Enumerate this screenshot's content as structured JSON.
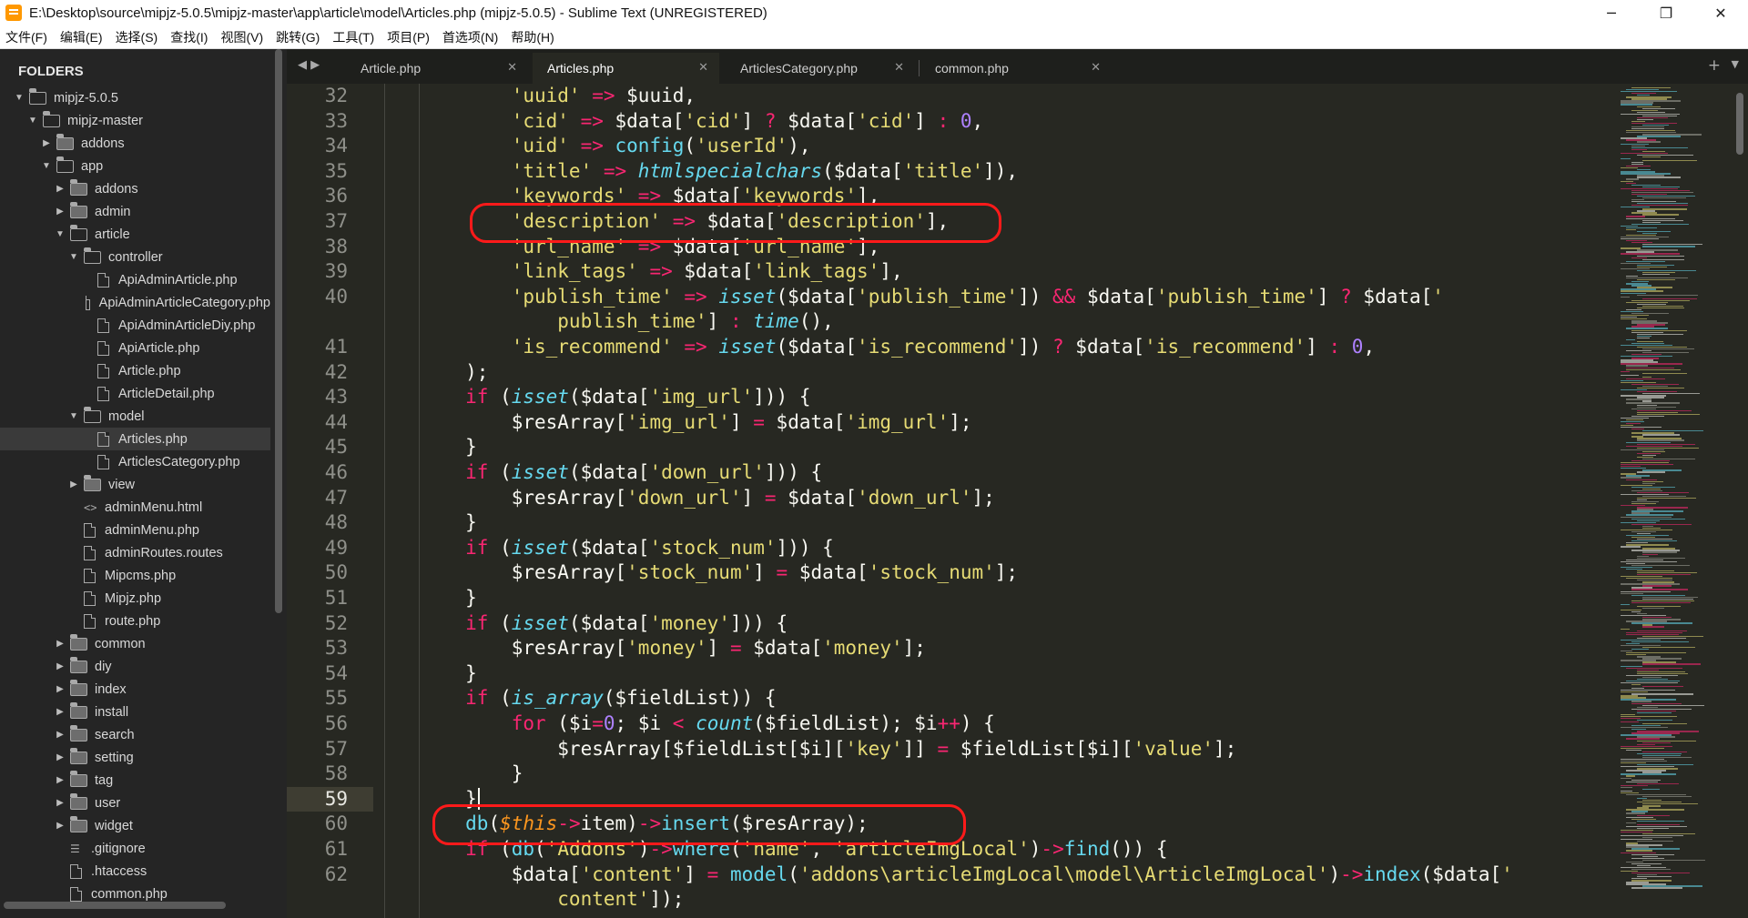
{
  "window": {
    "title": "E:\\Desktop\\source\\mipjz-5.0.5\\mipjz-master\\app\\article\\model\\Articles.php (mipjz-5.0.5) - Sublime Text (UNREGISTERED)",
    "minimize": "─",
    "restore": "❐",
    "close": "✕"
  },
  "menu": [
    "文件(F)",
    "编辑(E)",
    "选择(S)",
    "查找(I)",
    "视图(V)",
    "跳转(G)",
    "工具(T)",
    "项目(P)",
    "首选项(N)",
    "帮助(H)"
  ],
  "sidebar": {
    "title": "FOLDERS",
    "tree": [
      {
        "label": "mipjz-5.0.5",
        "type": "folder-open",
        "depth": 0
      },
      {
        "label": "mipjz-master",
        "type": "folder-open",
        "depth": 1
      },
      {
        "label": "addons",
        "type": "folder",
        "depth": 2
      },
      {
        "label": "app",
        "type": "folder-open",
        "depth": 2
      },
      {
        "label": "addons",
        "type": "folder",
        "depth": 3
      },
      {
        "label": "admin",
        "type": "folder",
        "depth": 3
      },
      {
        "label": "article",
        "type": "folder-open",
        "depth": 3
      },
      {
        "label": "controller",
        "type": "folder-open",
        "depth": 4
      },
      {
        "label": "ApiAdminArticle.php",
        "type": "file",
        "depth": 5
      },
      {
        "label": "ApiAdminArticleCategory.php",
        "type": "file",
        "depth": 5
      },
      {
        "label": "ApiAdminArticleDiy.php",
        "type": "file",
        "depth": 5
      },
      {
        "label": "ApiArticle.php",
        "type": "file",
        "depth": 5
      },
      {
        "label": "Article.php",
        "type": "file",
        "depth": 5
      },
      {
        "label": "ArticleDetail.php",
        "type": "file",
        "depth": 5
      },
      {
        "label": "model",
        "type": "folder-open",
        "depth": 4
      },
      {
        "label": "Articles.php",
        "type": "file",
        "depth": 5,
        "selected": true
      },
      {
        "label": "ArticlesCategory.php",
        "type": "file",
        "depth": 5
      },
      {
        "label": "view",
        "type": "folder",
        "depth": 4
      },
      {
        "label": "adminMenu.html",
        "type": "code",
        "depth": 4
      },
      {
        "label": "adminMenu.php",
        "type": "file",
        "depth": 4
      },
      {
        "label": "adminRoutes.routes",
        "type": "file",
        "depth": 4
      },
      {
        "label": "Mipcms.php",
        "type": "file",
        "depth": 4
      },
      {
        "label": "Mipjz.php",
        "type": "file",
        "depth": 4
      },
      {
        "label": "route.php",
        "type": "file",
        "depth": 4
      },
      {
        "label": "common",
        "type": "folder",
        "depth": 3
      },
      {
        "label": "diy",
        "type": "folder",
        "depth": 3
      },
      {
        "label": "index",
        "type": "folder",
        "depth": 3
      },
      {
        "label": "install",
        "type": "folder",
        "depth": 3
      },
      {
        "label": "search",
        "type": "folder",
        "depth": 3
      },
      {
        "label": "setting",
        "type": "folder",
        "depth": 3
      },
      {
        "label": "tag",
        "type": "folder",
        "depth": 3
      },
      {
        "label": "user",
        "type": "folder",
        "depth": 3
      },
      {
        "label": "widget",
        "type": "folder",
        "depth": 3
      },
      {
        "label": ".gitignore",
        "type": "lines",
        "depth": 3
      },
      {
        "label": ".htaccess",
        "type": "file",
        "depth": 3
      },
      {
        "label": "common.php",
        "type": "file",
        "depth": 3
      }
    ]
  },
  "tabs": [
    {
      "label": "Article.php",
      "close": "✕"
    },
    {
      "label": "Articles.php",
      "close": "✕",
      "active": true
    },
    {
      "label": "ArticlesCategory.php",
      "close": "✕"
    },
    {
      "label": "common.php",
      "close": "✕"
    }
  ],
  "tab_nav": "◀ ▶",
  "tab_plus": "+",
  "tab_menu": "▼",
  "editor": {
    "current_line": "59",
    "line_numbers": [
      "32",
      "33",
      "34",
      "35",
      "36",
      "37",
      "38",
      "39",
      "40",
      "",
      "41",
      "42",
      "43",
      "44",
      "45",
      "46",
      "47",
      "48",
      "49",
      "50",
      "51",
      "52",
      "53",
      "54",
      "55",
      "56",
      "57",
      "58",
      "59",
      "60",
      "61",
      "62",
      ""
    ],
    "code_lines": [
      [
        [
          "c-str",
          "            'uuid'"
        ],
        [
          "c-op",
          " =>"
        ],
        [
          "c-var",
          " $uuid,"
        ]
      ],
      [
        [
          "c-str",
          "            'cid'"
        ],
        [
          "c-op",
          " =>"
        ],
        [
          "c-var",
          " $data["
        ],
        [
          "c-str",
          "'cid'"
        ],
        [
          "c-var",
          "] "
        ],
        [
          "c-op",
          "?"
        ],
        [
          "c-var",
          " $data["
        ],
        [
          "c-str",
          "'cid'"
        ],
        [
          "c-var",
          "] "
        ],
        [
          "c-op",
          ":"
        ],
        [
          "c-num",
          " 0"
        ],
        [
          "c-var",
          ","
        ]
      ],
      [
        [
          "c-str",
          "            'uid'"
        ],
        [
          "c-op",
          " =>"
        ],
        [
          "c-call",
          " config"
        ],
        [
          "c-var",
          "("
        ],
        [
          "c-str",
          "'userId'"
        ],
        [
          "c-var",
          "),"
        ]
      ],
      [
        [
          "c-str",
          "            'title'"
        ],
        [
          "c-op",
          " =>"
        ],
        [
          "c-fn",
          " htmlspecialchars"
        ],
        [
          "c-var",
          "($data["
        ],
        [
          "c-str",
          "'title'"
        ],
        [
          "c-var",
          "]),"
        ]
      ],
      [
        [
          "c-str",
          "            'keywords'"
        ],
        [
          "c-op",
          " =>"
        ],
        [
          "c-var",
          " $data["
        ],
        [
          "c-str",
          "'keywords'"
        ],
        [
          "c-var",
          "],"
        ]
      ],
      [
        [
          "c-str",
          "            'description'"
        ],
        [
          "c-op",
          " =>"
        ],
        [
          "c-var",
          " $data["
        ],
        [
          "c-str",
          "'description'"
        ],
        [
          "c-var",
          "],"
        ]
      ],
      [
        [
          "c-str",
          "            'url_name'"
        ],
        [
          "c-op",
          " =>"
        ],
        [
          "c-var",
          " $data["
        ],
        [
          "c-str",
          "'url_name'"
        ],
        [
          "c-var",
          "],"
        ]
      ],
      [
        [
          "c-str",
          "            'link_tags'"
        ],
        [
          "c-op",
          " =>"
        ],
        [
          "c-var",
          " $data["
        ],
        [
          "c-str",
          "'link_tags'"
        ],
        [
          "c-var",
          "],"
        ]
      ],
      [
        [
          "c-str",
          "            'publish_time'"
        ],
        [
          "c-op",
          " =>"
        ],
        [
          "c-fn",
          " isset"
        ],
        [
          "c-var",
          "($data["
        ],
        [
          "c-str",
          "'publish_time'"
        ],
        [
          "c-var",
          "]) "
        ],
        [
          "c-op",
          "&&"
        ],
        [
          "c-var",
          " $data["
        ],
        [
          "c-str",
          "'publish_time'"
        ],
        [
          "c-var",
          "] "
        ],
        [
          "c-op",
          "?"
        ],
        [
          "c-var",
          " $data["
        ],
        [
          "c-str",
          "'"
        ]
      ],
      [
        [
          "c-str",
          "                publish_time'"
        ],
        [
          "c-var",
          "] "
        ],
        [
          "c-op",
          ":"
        ],
        [
          "c-fn",
          " time"
        ],
        [
          "c-var",
          "(),"
        ]
      ],
      [
        [
          "c-str",
          "            'is_recommend'"
        ],
        [
          "c-op",
          " =>"
        ],
        [
          "c-fn",
          " isset"
        ],
        [
          "c-var",
          "($data["
        ],
        [
          "c-str",
          "'is_recommend'"
        ],
        [
          "c-var",
          "]) "
        ],
        [
          "c-op",
          "?"
        ],
        [
          "c-var",
          " $data["
        ],
        [
          "c-str",
          "'is_recommend'"
        ],
        [
          "c-var",
          "] "
        ],
        [
          "c-op",
          ":"
        ],
        [
          "c-num",
          " 0"
        ],
        [
          "c-var",
          ","
        ]
      ],
      [
        [
          "c-var",
          "        );"
        ]
      ],
      [
        [
          "c-kw",
          "        if"
        ],
        [
          "c-var",
          " ("
        ],
        [
          "c-fn",
          "isset"
        ],
        [
          "c-var",
          "($data["
        ],
        [
          "c-str",
          "'img_url'"
        ],
        [
          "c-var",
          "])) {"
        ]
      ],
      [
        [
          "c-var",
          "            $resArray["
        ],
        [
          "c-str",
          "'img_url'"
        ],
        [
          "c-var",
          "] "
        ],
        [
          "c-op",
          "="
        ],
        [
          "c-var",
          " $data["
        ],
        [
          "c-str",
          "'img_url'"
        ],
        [
          "c-var",
          "];"
        ]
      ],
      [
        [
          "c-var",
          "        }"
        ]
      ],
      [
        [
          "c-kw",
          "        if"
        ],
        [
          "c-var",
          " ("
        ],
        [
          "c-fn",
          "isset"
        ],
        [
          "c-var",
          "($data["
        ],
        [
          "c-str",
          "'down_url'"
        ],
        [
          "c-var",
          "])) {"
        ]
      ],
      [
        [
          "c-var",
          "            $resArray["
        ],
        [
          "c-str",
          "'down_url'"
        ],
        [
          "c-var",
          "] "
        ],
        [
          "c-op",
          "="
        ],
        [
          "c-var",
          " $data["
        ],
        [
          "c-str",
          "'down_url'"
        ],
        [
          "c-var",
          "];"
        ]
      ],
      [
        [
          "c-var",
          "        }"
        ]
      ],
      [
        [
          "c-kw",
          "        if"
        ],
        [
          "c-var",
          " ("
        ],
        [
          "c-fn",
          "isset"
        ],
        [
          "c-var",
          "($data["
        ],
        [
          "c-str",
          "'stock_num'"
        ],
        [
          "c-var",
          "])) {"
        ]
      ],
      [
        [
          "c-var",
          "            $resArray["
        ],
        [
          "c-str",
          "'stock_num'"
        ],
        [
          "c-var",
          "] "
        ],
        [
          "c-op",
          "="
        ],
        [
          "c-var",
          " $data["
        ],
        [
          "c-str",
          "'stock_num'"
        ],
        [
          "c-var",
          "];"
        ]
      ],
      [
        [
          "c-var",
          "        }"
        ]
      ],
      [
        [
          "c-kw",
          "        if"
        ],
        [
          "c-var",
          " ("
        ],
        [
          "c-fn",
          "isset"
        ],
        [
          "c-var",
          "($data["
        ],
        [
          "c-str",
          "'money'"
        ],
        [
          "c-var",
          "])) {"
        ]
      ],
      [
        [
          "c-var",
          "            $resArray["
        ],
        [
          "c-str",
          "'money'"
        ],
        [
          "c-var",
          "] "
        ],
        [
          "c-op",
          "="
        ],
        [
          "c-var",
          " $data["
        ],
        [
          "c-str",
          "'money'"
        ],
        [
          "c-var",
          "];"
        ]
      ],
      [
        [
          "c-var",
          "        }"
        ]
      ],
      [
        [
          "c-kw",
          "        if"
        ],
        [
          "c-var",
          " ("
        ],
        [
          "c-fn",
          "is_array"
        ],
        [
          "c-var",
          "($fieldList)) {"
        ]
      ],
      [
        [
          "c-kw",
          "            for"
        ],
        [
          "c-var",
          " ($i"
        ],
        [
          "c-op",
          "="
        ],
        [
          "c-num",
          "0"
        ],
        [
          "c-var",
          "; $i "
        ],
        [
          "c-op",
          "<"
        ],
        [
          "c-fn",
          " count"
        ],
        [
          "c-var",
          "($fieldList); $i"
        ],
        [
          "c-op",
          "++"
        ],
        [
          "c-var",
          ") {"
        ]
      ],
      [
        [
          "c-var",
          "                $resArray[$fieldList[$i]["
        ],
        [
          "c-str",
          "'key'"
        ],
        [
          "c-var",
          "]] "
        ],
        [
          "c-op",
          "="
        ],
        [
          "c-var",
          " $fieldList[$i]["
        ],
        [
          "c-str",
          "'value'"
        ],
        [
          "c-var",
          "];"
        ]
      ],
      [
        [
          "c-var",
          "            }"
        ]
      ],
      [
        [
          "c-var",
          "        }"
        ]
      ],
      [
        [
          "c-call",
          "        db"
        ],
        [
          "c-var",
          "("
        ],
        [
          "c-this",
          "$this"
        ],
        [
          "c-op",
          "->"
        ],
        [
          "c-var",
          "item)"
        ],
        [
          "c-op",
          "->"
        ],
        [
          "c-call",
          "insert"
        ],
        [
          "c-var",
          "($resArray);"
        ]
      ],
      [
        [
          "c-kw",
          "        if"
        ],
        [
          "c-var",
          " ("
        ],
        [
          "c-call",
          "db"
        ],
        [
          "c-var",
          "("
        ],
        [
          "c-str",
          "'Addons'"
        ],
        [
          "c-var",
          ")"
        ],
        [
          "c-op",
          "->"
        ],
        [
          "c-call",
          "where"
        ],
        [
          "c-var",
          "("
        ],
        [
          "c-str",
          "'name'"
        ],
        [
          "c-var",
          ", "
        ],
        [
          "c-str",
          "'articleImgLocal'"
        ],
        [
          "c-var",
          ")"
        ],
        [
          "c-op",
          "->"
        ],
        [
          "c-call",
          "find"
        ],
        [
          "c-var",
          "()) {"
        ]
      ],
      [
        [
          "c-var",
          "            $data["
        ],
        [
          "c-str",
          "'content'"
        ],
        [
          "c-var",
          "] "
        ],
        [
          "c-op",
          "="
        ],
        [
          "c-call",
          " model"
        ],
        [
          "c-var",
          "("
        ],
        [
          "c-str",
          "'addons\\articleImgLocal\\model\\ArticleImgLocal'"
        ],
        [
          "c-var",
          ")"
        ],
        [
          "c-op",
          "->"
        ],
        [
          "c-call",
          "index"
        ],
        [
          "c-var",
          "($data["
        ],
        [
          "c-str",
          "'"
        ]
      ],
      [
        [
          "c-str",
          "                content'"
        ],
        [
          "c-var",
          "]);"
        ]
      ]
    ]
  },
  "colors": {
    "background": "#272822",
    "sidebar": "#252525",
    "string": "#e6db74",
    "keyword": "#f92672",
    "function": "#66d9ef",
    "number": "#ae81ff",
    "highlight": "#ff1a1a"
  }
}
